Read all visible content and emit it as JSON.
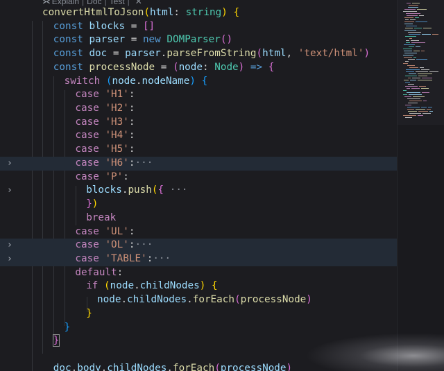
{
  "codelens": {
    "items": [
      "Explain",
      "Doc",
      "Test"
    ],
    "close_glyph": "✕"
  },
  "code_lines": [
    [
      [
        "fn",
        "convertHtmlToJson"
      ],
      [
        "br1",
        "("
      ],
      [
        "va",
        "html"
      ],
      [
        "pu",
        ": "
      ],
      [
        "ty",
        "string"
      ],
      [
        "br1",
        ")"
      ],
      [
        "pu",
        " "
      ],
      [
        "br1",
        "{"
      ]
    ],
    [
      [
        "st",
        "const "
      ],
      [
        "va",
        "blocks"
      ],
      [
        "pu",
        " = "
      ],
      [
        "br2",
        "[]"
      ]
    ],
    [
      [
        "st",
        "const "
      ],
      [
        "va",
        "parser"
      ],
      [
        "pu",
        " = "
      ],
      [
        "st",
        "new "
      ],
      [
        "ty",
        "DOMParser"
      ],
      [
        "br2",
        "()"
      ]
    ],
    [
      [
        "st",
        "const "
      ],
      [
        "va",
        "doc"
      ],
      [
        "pu",
        " = "
      ],
      [
        "va",
        "parser"
      ],
      [
        "pu",
        "."
      ],
      [
        "fn",
        "parseFromString"
      ],
      [
        "br2",
        "("
      ],
      [
        "va",
        "html"
      ],
      [
        "pu",
        ", "
      ],
      [
        "s",
        "'text/html'"
      ],
      [
        "br2",
        ")"
      ]
    ],
    [
      [
        "st",
        "const "
      ],
      [
        "fn",
        "processNode"
      ],
      [
        "pu",
        " = "
      ],
      [
        "br2",
        "("
      ],
      [
        "va",
        "node"
      ],
      [
        "pu",
        ": "
      ],
      [
        "ty",
        "Node"
      ],
      [
        "br2",
        ")"
      ],
      [
        "st",
        " => "
      ],
      [
        "br2",
        "{"
      ]
    ],
    [
      [
        "kw",
        "switch "
      ],
      [
        "br3",
        "("
      ],
      [
        "va",
        "node"
      ],
      [
        "pu",
        "."
      ],
      [
        "va",
        "nodeName"
      ],
      [
        "br3",
        ")"
      ],
      [
        "pu",
        " "
      ],
      [
        "br3",
        "{"
      ]
    ],
    [
      [
        "kw",
        "case "
      ],
      [
        "s",
        "'H1'"
      ],
      [
        "pu",
        ":"
      ]
    ],
    [
      [
        "kw",
        "case "
      ],
      [
        "s",
        "'H2'"
      ],
      [
        "pu",
        ":"
      ]
    ],
    [
      [
        "kw",
        "case "
      ],
      [
        "s",
        "'H3'"
      ],
      [
        "pu",
        ":"
      ]
    ],
    [
      [
        "kw",
        "case "
      ],
      [
        "s",
        "'H4'"
      ],
      [
        "pu",
        ":"
      ]
    ],
    [
      [
        "kw",
        "case "
      ],
      [
        "s",
        "'H5'"
      ],
      [
        "pu",
        ":"
      ]
    ],
    [
      [
        "kw",
        "case "
      ],
      [
        "s",
        "'H6'"
      ],
      [
        "pu",
        ":"
      ],
      [
        "ell",
        "···"
      ]
    ],
    [
      [
        "kw",
        "case "
      ],
      [
        "s",
        "'P'"
      ],
      [
        "pu",
        ":"
      ]
    ],
    [
      [
        "va",
        "blocks"
      ],
      [
        "pu",
        "."
      ],
      [
        "fn",
        "push"
      ],
      [
        "br1",
        "("
      ],
      [
        "br2",
        "{"
      ],
      [
        "ell",
        " ···"
      ]
    ],
    [
      [
        "br2",
        "}"
      ],
      [
        "br1",
        ")"
      ]
    ],
    [
      [
        "kw",
        "break"
      ]
    ],
    [
      [
        "kw",
        "case "
      ],
      [
        "s",
        "'UL'"
      ],
      [
        "pu",
        ":"
      ]
    ],
    [
      [
        "kw",
        "case "
      ],
      [
        "s",
        "'OL'"
      ],
      [
        "pu",
        ":"
      ],
      [
        "ell",
        "···"
      ]
    ],
    [
      [
        "kw",
        "case "
      ],
      [
        "s",
        "'TABLE'"
      ],
      [
        "pu",
        ":"
      ],
      [
        "ell",
        "···"
      ]
    ],
    [
      [
        "kw",
        "default"
      ],
      [
        "pu",
        ":"
      ]
    ],
    [
      [
        "kw",
        "if "
      ],
      [
        "br1",
        "("
      ],
      [
        "va",
        "node"
      ],
      [
        "pu",
        "."
      ],
      [
        "va",
        "childNodes"
      ],
      [
        "br1",
        ")"
      ],
      [
        "pu",
        " "
      ],
      [
        "br1",
        "{"
      ]
    ],
    [
      [
        "va",
        "node"
      ],
      [
        "pu",
        "."
      ],
      [
        "va",
        "childNodes"
      ],
      [
        "pu",
        "."
      ],
      [
        "fn",
        "forEach"
      ],
      [
        "br2",
        "("
      ],
      [
        "fn",
        "processNode"
      ],
      [
        "br2",
        ")"
      ]
    ],
    [
      [
        "br1",
        "}"
      ]
    ],
    [
      [
        "br3",
        "}"
      ]
    ],
    [
      [
        "br2",
        "}"
      ]
    ],
    [],
    [
      [
        "va",
        "doc"
      ],
      [
        "pu",
        "."
      ],
      [
        "va",
        "body"
      ],
      [
        "pu",
        "."
      ],
      [
        "va",
        "childNodes"
      ],
      [
        "pu",
        "."
      ],
      [
        "fn",
        "forEach"
      ],
      [
        "br2",
        "("
      ],
      [
        "va",
        "processNode"
      ],
      [
        "br2",
        ")"
      ]
    ]
  ],
  "fold_glyph": "›",
  "folded_lines": [
    11,
    13,
    17,
    18
  ],
  "highlighted_lines": [
    11,
    17,
    18
  ],
  "cursor_line": 24,
  "colors": {
    "background": "#1c1c20",
    "keyword": "#c586c0",
    "storage": "#569cd6",
    "function": "#dcdcaa",
    "variable": "#9cdcfe",
    "type": "#4ec9b0",
    "string": "#ce9178"
  }
}
